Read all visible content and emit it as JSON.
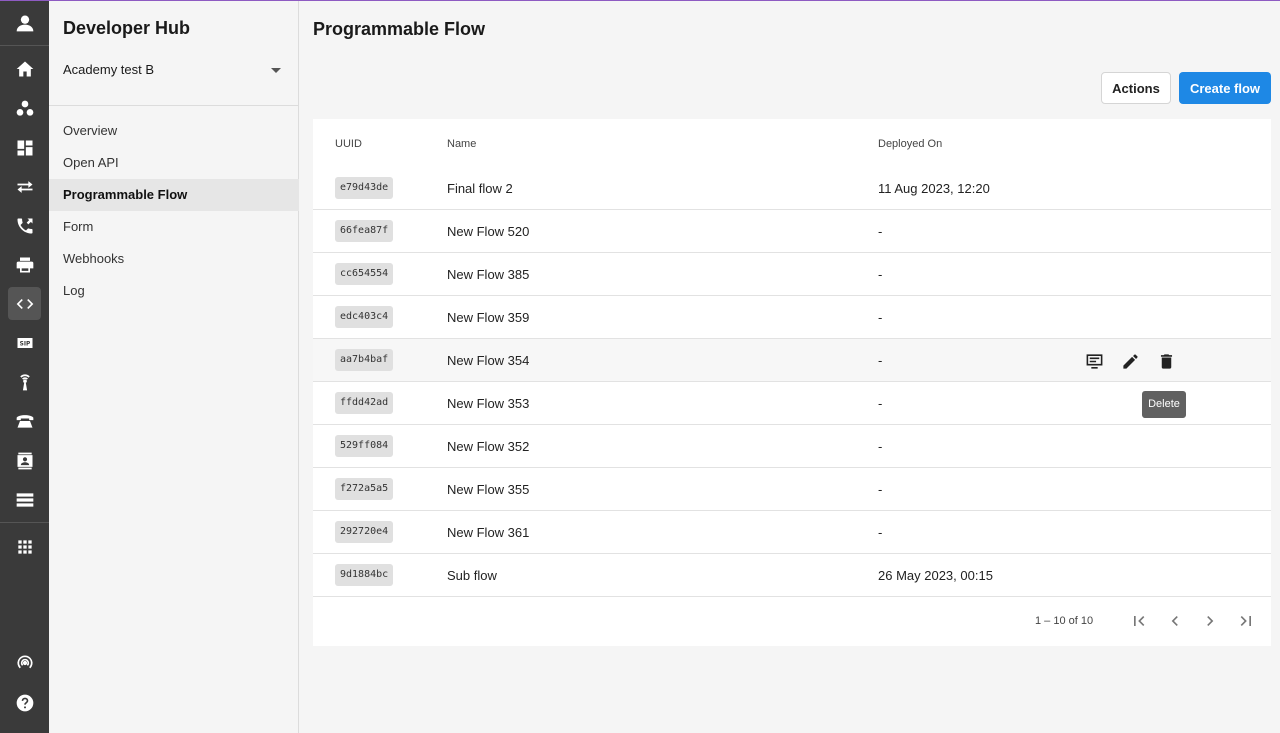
{
  "rail": {
    "icons": [
      "profile-icon",
      "home-icon",
      "groups-icon",
      "dashboard-icon",
      "transfer-icon",
      "phone-forward-icon",
      "print-icon",
      "code-icon",
      "sip-icon",
      "broadcast-icon",
      "telephone-icon",
      "contact-icon",
      "server-icon",
      "apps-icon",
      "signal-icon",
      "help-icon"
    ],
    "active": "code-icon"
  },
  "sidebar": {
    "title": "Developer Hub",
    "account": "Academy test B",
    "items": [
      {
        "label": "Overview"
      },
      {
        "label": "Open API"
      },
      {
        "label": "Programmable Flow",
        "active": true
      },
      {
        "label": "Form"
      },
      {
        "label": "Webhooks"
      },
      {
        "label": "Log"
      }
    ]
  },
  "main": {
    "title": "Programmable Flow",
    "actions_label": "Actions",
    "create_label": "Create flow"
  },
  "table": {
    "headers": {
      "uuid": "UUID",
      "name": "Name",
      "deployed": "Deployed On"
    },
    "rows": [
      {
        "uuid": "e79d43de",
        "name": "Final flow 2",
        "deployed": "11 Aug 2023, 12:20"
      },
      {
        "uuid": "66fea87f",
        "name": "New Flow 520",
        "deployed": "-"
      },
      {
        "uuid": "cc654554",
        "name": "New Flow 385",
        "deployed": "-"
      },
      {
        "uuid": "edc403c4",
        "name": "New Flow 359",
        "deployed": "-"
      },
      {
        "uuid": "aa7b4baf",
        "name": "New Flow 354",
        "deployed": "-"
      },
      {
        "uuid": "ffdd42ad",
        "name": "New Flow 353",
        "deployed": "-"
      },
      {
        "uuid": "529ff084",
        "name": "New Flow 352",
        "deployed": "-"
      },
      {
        "uuid": "f272a5a5",
        "name": "New Flow 355",
        "deployed": "-"
      },
      {
        "uuid": "292720e4",
        "name": "New Flow 361",
        "deployed": "-"
      },
      {
        "uuid": "9d1884bc",
        "name": "Sub flow",
        "deployed": "26 May 2023, 00:15"
      }
    ],
    "hover_row": 4,
    "row_action_icons": [
      "monitor-icon",
      "edit-icon",
      "delete-icon"
    ],
    "tooltip": "Delete"
  },
  "pager": {
    "range": "1 – 10 of 10"
  }
}
